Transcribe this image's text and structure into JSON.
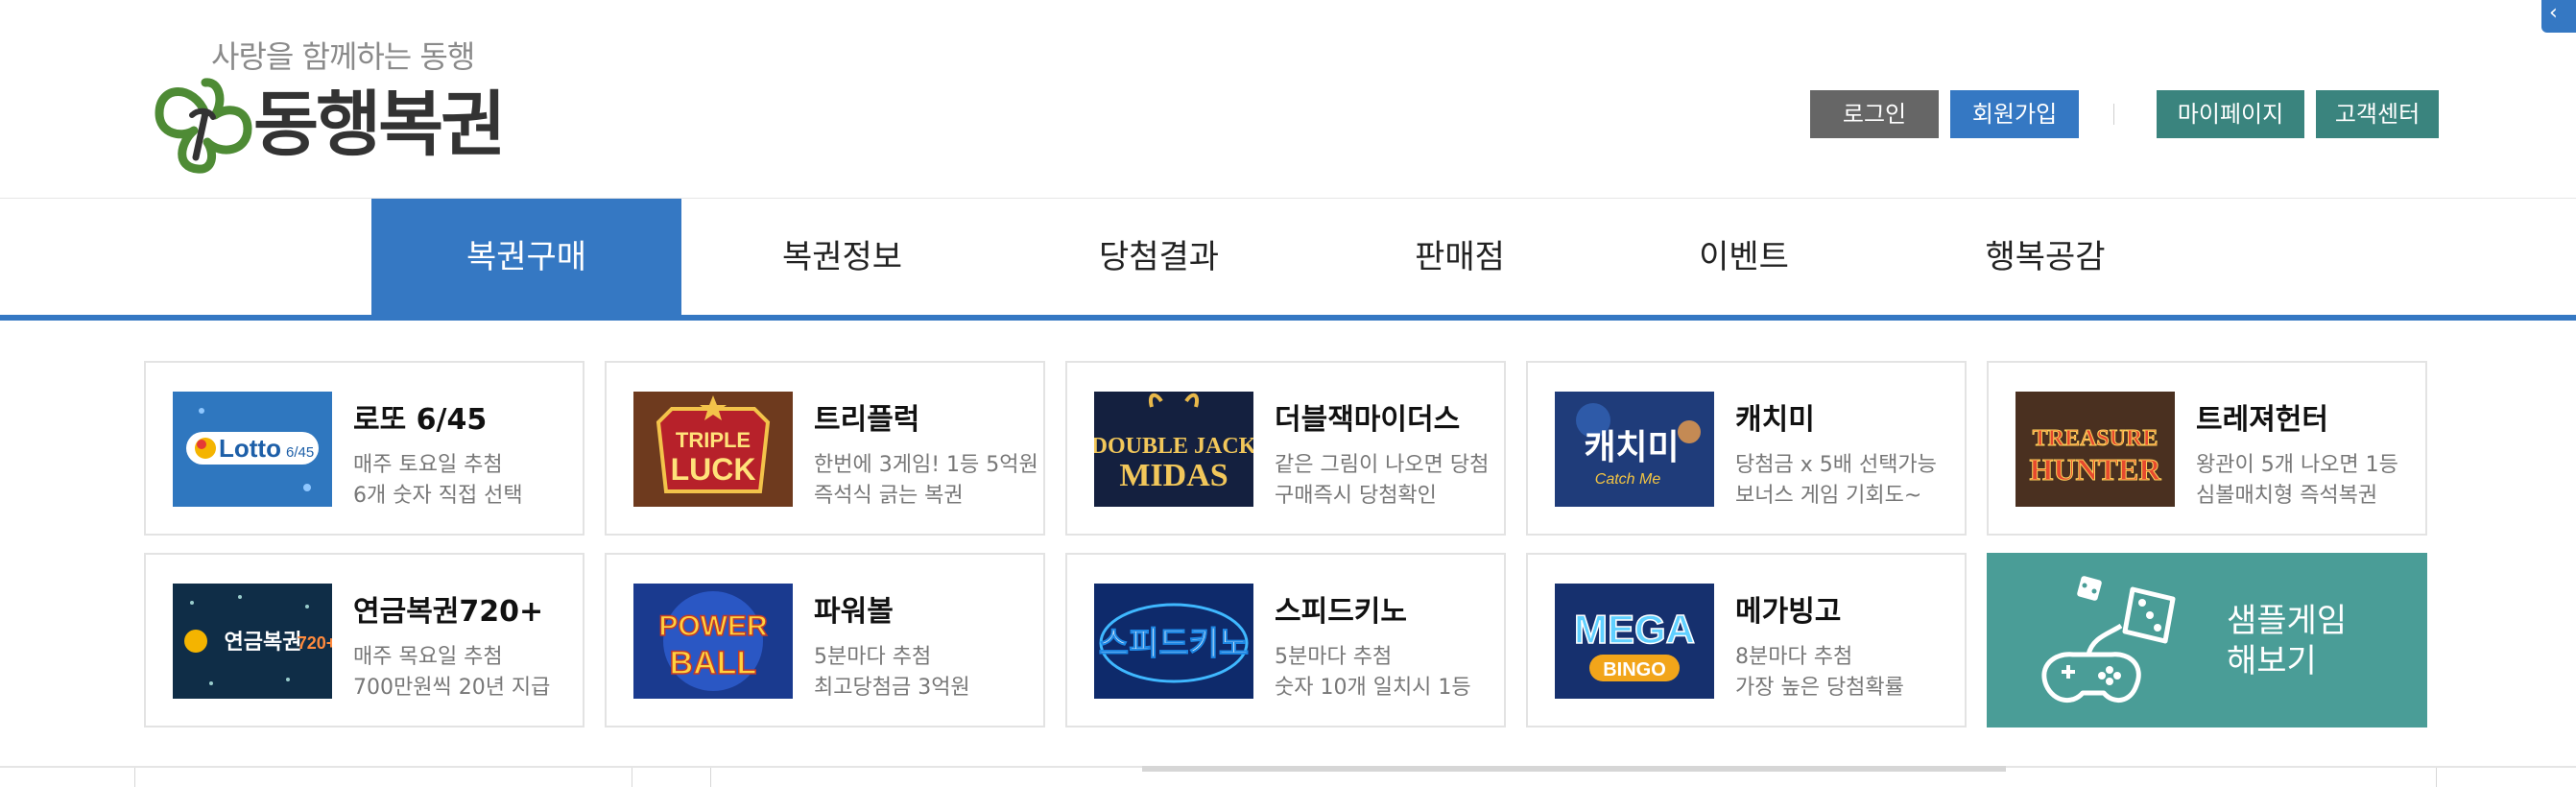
{
  "brand": {
    "tagline": "사랑을 함께하는 동행",
    "name": "동행복권",
    "colors": {
      "primary": "#3578c3",
      "teal": "#3a847e",
      "green_logo": "#4e8b35",
      "dark_logo": "#333333"
    }
  },
  "util_menu": {
    "login": "로그인",
    "signup": "회원가입",
    "mypage": "마이페이지",
    "customer_center": "고객센터"
  },
  "nav": {
    "items": [
      {
        "label": "복권구매",
        "active": true
      },
      {
        "label": "복권정보",
        "active": false
      },
      {
        "label": "당첨결과",
        "active": false
      },
      {
        "label": "판매점",
        "active": false
      },
      {
        "label": "이벤트",
        "active": false
      },
      {
        "label": "행복공감",
        "active": false
      }
    ]
  },
  "games": [
    {
      "title": "로또 6/45",
      "line1": "매주 토요일 추첨",
      "line2": "6개 숫자 직접 선택",
      "thumb": "Lotto 6/45"
    },
    {
      "title": "트리플럭",
      "line1": "한번에 3게임! 1등 5억원",
      "line2": "즉석식 긁는 복권",
      "thumb": "TRIPLE LUCK"
    },
    {
      "title": "더블잭마이더스",
      "line1": "같은 그림이 나오면 당첨",
      "line2": "구매즉시 당첨확인",
      "thumb": "DOUBLE JACK MIDAS"
    },
    {
      "title": "캐치미",
      "line1": "당첨금 x 5배 선택가능",
      "line2": "보너스 게임 기회도~",
      "thumb": "캐치미 Catch Me"
    },
    {
      "title": "트레져헌터",
      "line1": "왕관이 5개 나오면 1등",
      "line2": "심볼매치형 즉석복권",
      "thumb": "TREASURE HUNTER"
    },
    {
      "title": "연금복권720+",
      "line1": "매주 목요일 추첨",
      "line2": "700만원씩 20년 지급",
      "thumb": "연금복권720+"
    },
    {
      "title": "파워볼",
      "line1": "5분마다 추첨",
      "line2": "최고당첨금 3억원",
      "thumb": "POWER BALL"
    },
    {
      "title": "스피드키노",
      "line1": "5분마다 추첨",
      "line2": "숫자 10개 일치시 1등",
      "thumb": "스피드키노"
    },
    {
      "title": "메가빙고",
      "line1": "8분마다 추첨",
      "line2": "가장 높은 당첨확률",
      "thumb": "MEGA BINGO"
    }
  ],
  "sample_game": {
    "label": "샘플게임\n해보기"
  }
}
